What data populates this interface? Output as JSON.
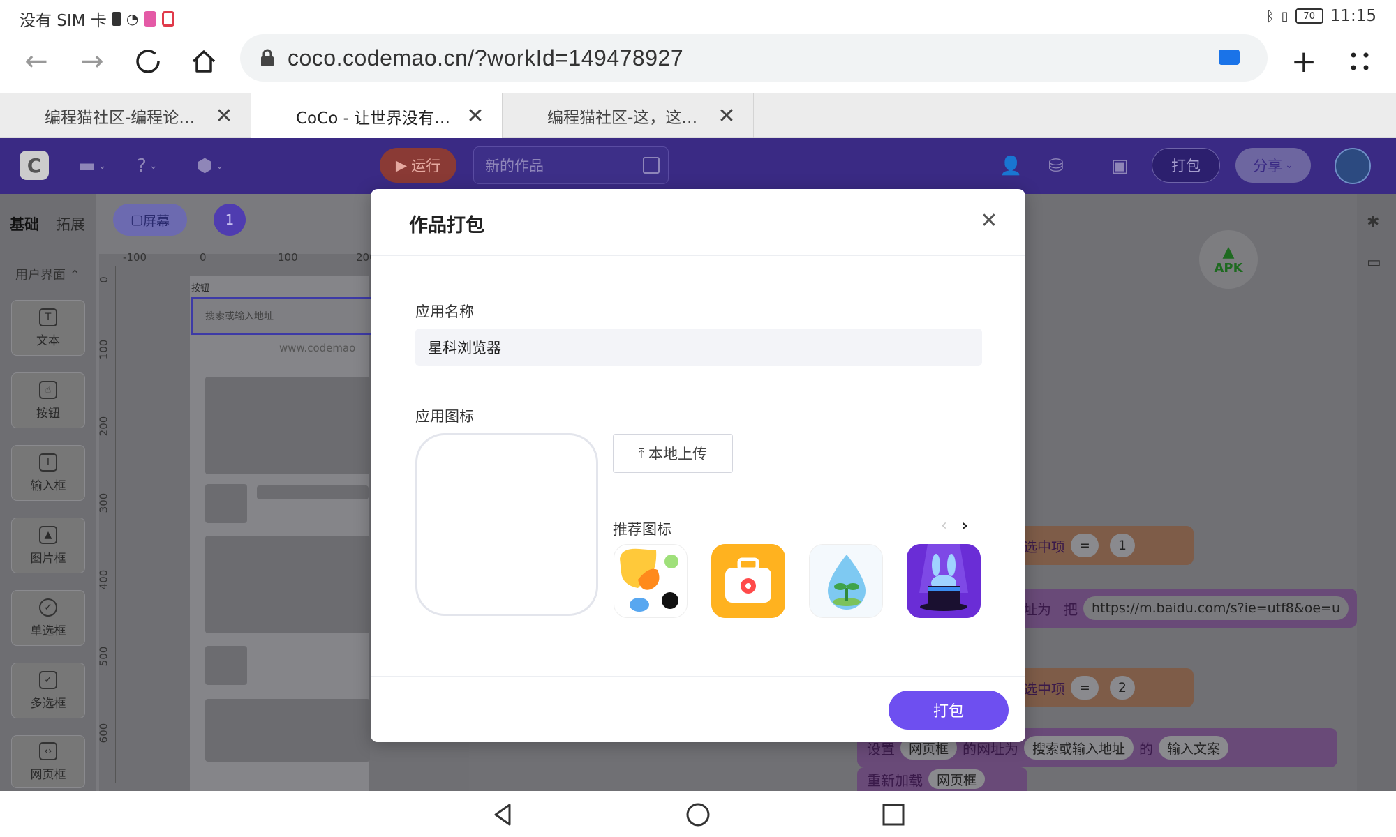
{
  "status_bar": {
    "carrier": "没有 SIM 卡",
    "battery": "70",
    "time": "11:15"
  },
  "browser": {
    "url": "coco.codemao.cn/?workId=149478927",
    "tabs": [
      {
        "label": "编程猫社区-编程论…",
        "active": false
      },
      {
        "label": "CoCo - 让世界没有…",
        "active": true
      },
      {
        "label": "编程猫社区-这，这…",
        "active": false
      }
    ],
    "close_glyph": "✕"
  },
  "app_header": {
    "run_label": "运行",
    "project_name": "新的作品",
    "pack_label": "打包",
    "share_label": "分享"
  },
  "workspace": {
    "palette_tabs": [
      "基础",
      "拓展"
    ],
    "section_label": "用户界面",
    "palette_items": [
      "文本",
      "按钮",
      "输入框",
      "图片框",
      "单选框",
      "多选框",
      "网页框"
    ],
    "screen_chip": "屏幕",
    "screen_count": "1",
    "ruler_top": [
      "-100",
      "0",
      "100",
      "200"
    ],
    "ruler_left": [
      "0",
      "100",
      "200",
      "300",
      "400",
      "500",
      "600"
    ],
    "stage_button_label": "按钮",
    "stage_search_placeholder": "搜索或输入地址",
    "stage_site": "www.codemao",
    "apk_label": "APK",
    "code_blocks": {
      "selected_item_1": "选中项",
      "eq_1": "=",
      "val_1": "1",
      "set_url_to": "址为",
      "set_url_keyword": "把",
      "url_value": "https://m.baidu.com/s?ie=utf8&oe=u",
      "selected_item_2": "选中项",
      "eq_2": "=",
      "val_2": "2",
      "set_label": "设置",
      "webview_chip": "网页框",
      "url_of": "的网址为",
      "search_chip": "搜索或输入地址",
      "of_label": "的",
      "input_text_chip": "输入文案",
      "reload_label": "重新加载",
      "reload_chip": "网页框"
    }
  },
  "modal": {
    "title": "作品打包",
    "app_name_label": "应用名称",
    "app_name_value": "星科浏览器",
    "app_icon_label": "应用图标",
    "upload_label": "本地上传",
    "recommend_label": "推荐图标",
    "pack_button": "打包",
    "recommended_icons": [
      "paint-splash-icon",
      "medical-kit-icon",
      "water-drop-sprout-icon",
      "magic-hat-rabbit-icon"
    ]
  },
  "colors": {
    "header_bg": "#3a2a84",
    "primary": "#6e4ff0",
    "run": "#ff6a3d"
  }
}
